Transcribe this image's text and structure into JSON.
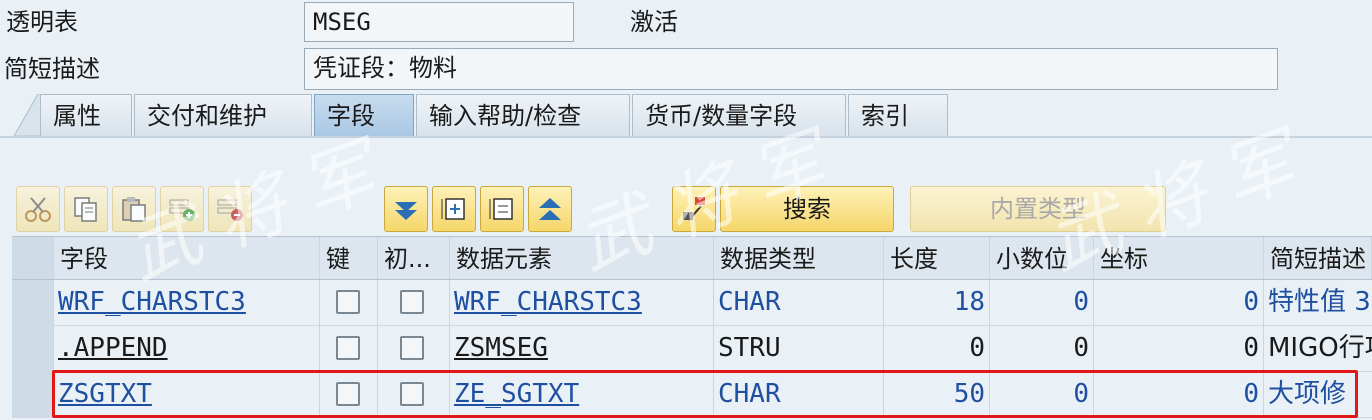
{
  "header": {
    "table_type_label": "透明表",
    "table_name": "MSEG",
    "status": "激活",
    "short_desc_label": "简短描述",
    "short_desc_value": "凭证段：物料"
  },
  "tabs": [
    {
      "label": "属性"
    },
    {
      "label": "交付和维护"
    },
    {
      "label": "字段",
      "active": true
    },
    {
      "label": "输入帮助/检查"
    },
    {
      "label": "货币/数量字段"
    },
    {
      "label": "索引"
    }
  ],
  "toolbar": {
    "icons": [
      "cut-icon",
      "copy-icon",
      "paste-icon",
      "insert-row-icon",
      "delete-row-icon",
      "expand-icon",
      "add-node-icon",
      "select-icon",
      "collapse-icon",
      "hierarchy-icon"
    ],
    "search_label": "搜索",
    "builtin_type_label": "内置类型"
  },
  "watermark": "武将军",
  "table": {
    "columns": [
      "字段",
      "键",
      "初...",
      "数据元素",
      "数据类型",
      "长度",
      "小数位",
      "坐标",
      "简短描述"
    ],
    "rows": [
      {
        "field": "WRF_CHARSTC3",
        "key": false,
        "init": false,
        "data_element": "WRF_CHARSTC3",
        "data_type": "CHAR",
        "length": "18",
        "decimals": "0",
        "coord": "0",
        "desc": "特性值 3"
      },
      {
        "field": ".APPEND",
        "key": false,
        "init": false,
        "data_element": "ZSMSEG",
        "data_type": "STRU",
        "length": "0",
        "decimals": "0",
        "coord": "0",
        "desc": "MIGO行项"
      },
      {
        "field": "ZSGTXT",
        "key": false,
        "init": false,
        "data_element": "ZE_SGTXT",
        "data_type": "CHAR",
        "length": "50",
        "decimals": "0",
        "coord": "0",
        "desc": "大项修"
      }
    ]
  },
  "colors": {
    "highlight_border": "#e01818",
    "link": "#1f4fa0",
    "button": "#f5d66a"
  }
}
